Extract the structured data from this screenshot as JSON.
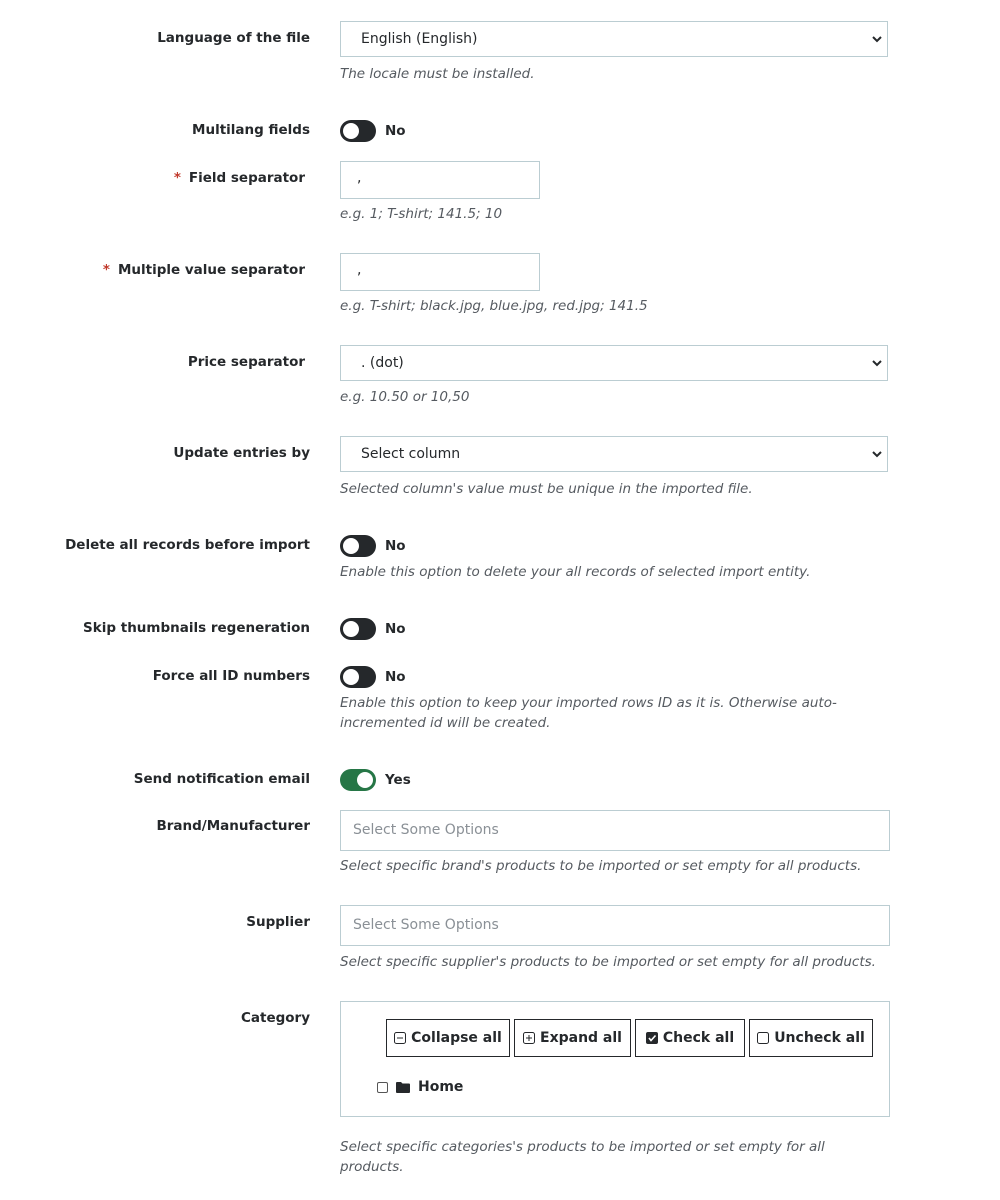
{
  "form": {
    "language": {
      "label": "Language of the file",
      "value": "English (English)",
      "help": "The locale must be installed."
    },
    "multilang": {
      "label": "Multilang fields",
      "state": "No"
    },
    "field_separator": {
      "required_mark": "*",
      "label": "Field separator",
      "value": ",",
      "help": "e.g. 1; T-shirt; 141.5; 10"
    },
    "multiple_value_separator": {
      "required_mark": "*",
      "label": "Multiple value separator",
      "value": ",",
      "help": "e.g. T-shirt; black.jpg, blue.jpg, red.jpg; 141.5"
    },
    "price_separator": {
      "label": "Price separator",
      "value": ". (dot)",
      "help": "e.g. 10.50 or 10,50"
    },
    "update_entries": {
      "label": "Update entries by",
      "value": "Select column",
      "help": "Selected column's value must be unique in the imported file."
    },
    "delete_records": {
      "label": "Delete all records before import",
      "state": "No",
      "help": "Enable this option to delete your all records of selected import entity."
    },
    "skip_thumbnails": {
      "label": "Skip thumbnails regeneration",
      "state": "No"
    },
    "force_ids": {
      "label": "Force all ID numbers",
      "state": "No",
      "help": "Enable this option to keep your imported rows ID as it is. Otherwise auto-incremented id will be created."
    },
    "send_email": {
      "label": "Send notification email",
      "state": "Yes"
    },
    "brand": {
      "label": "Brand/Manufacturer",
      "placeholder": "Select Some Options",
      "help": "Select specific brand's products to be imported or set empty for all products."
    },
    "supplier": {
      "label": "Supplier",
      "placeholder": "Select Some Options",
      "help": "Select specific supplier's products to be imported or set empty for all products."
    },
    "category": {
      "label": "Category",
      "buttons": {
        "collapse": "Collapse all",
        "expand": "Expand all",
        "check": "Check all",
        "uncheck": "Uncheck all"
      },
      "tree_root": "Home",
      "help": "Select specific categories's products to be imported or set empty for all products."
    }
  },
  "colors": {
    "toggle_on": "#267646",
    "toggle_off": "#25282b",
    "required": "#c0392b",
    "border": "#bbcdd2"
  },
  "icons": [
    "chevron-down-icon",
    "minus-square-icon",
    "plus-square-icon",
    "check-square-icon",
    "square-icon",
    "folder-icon"
  ]
}
